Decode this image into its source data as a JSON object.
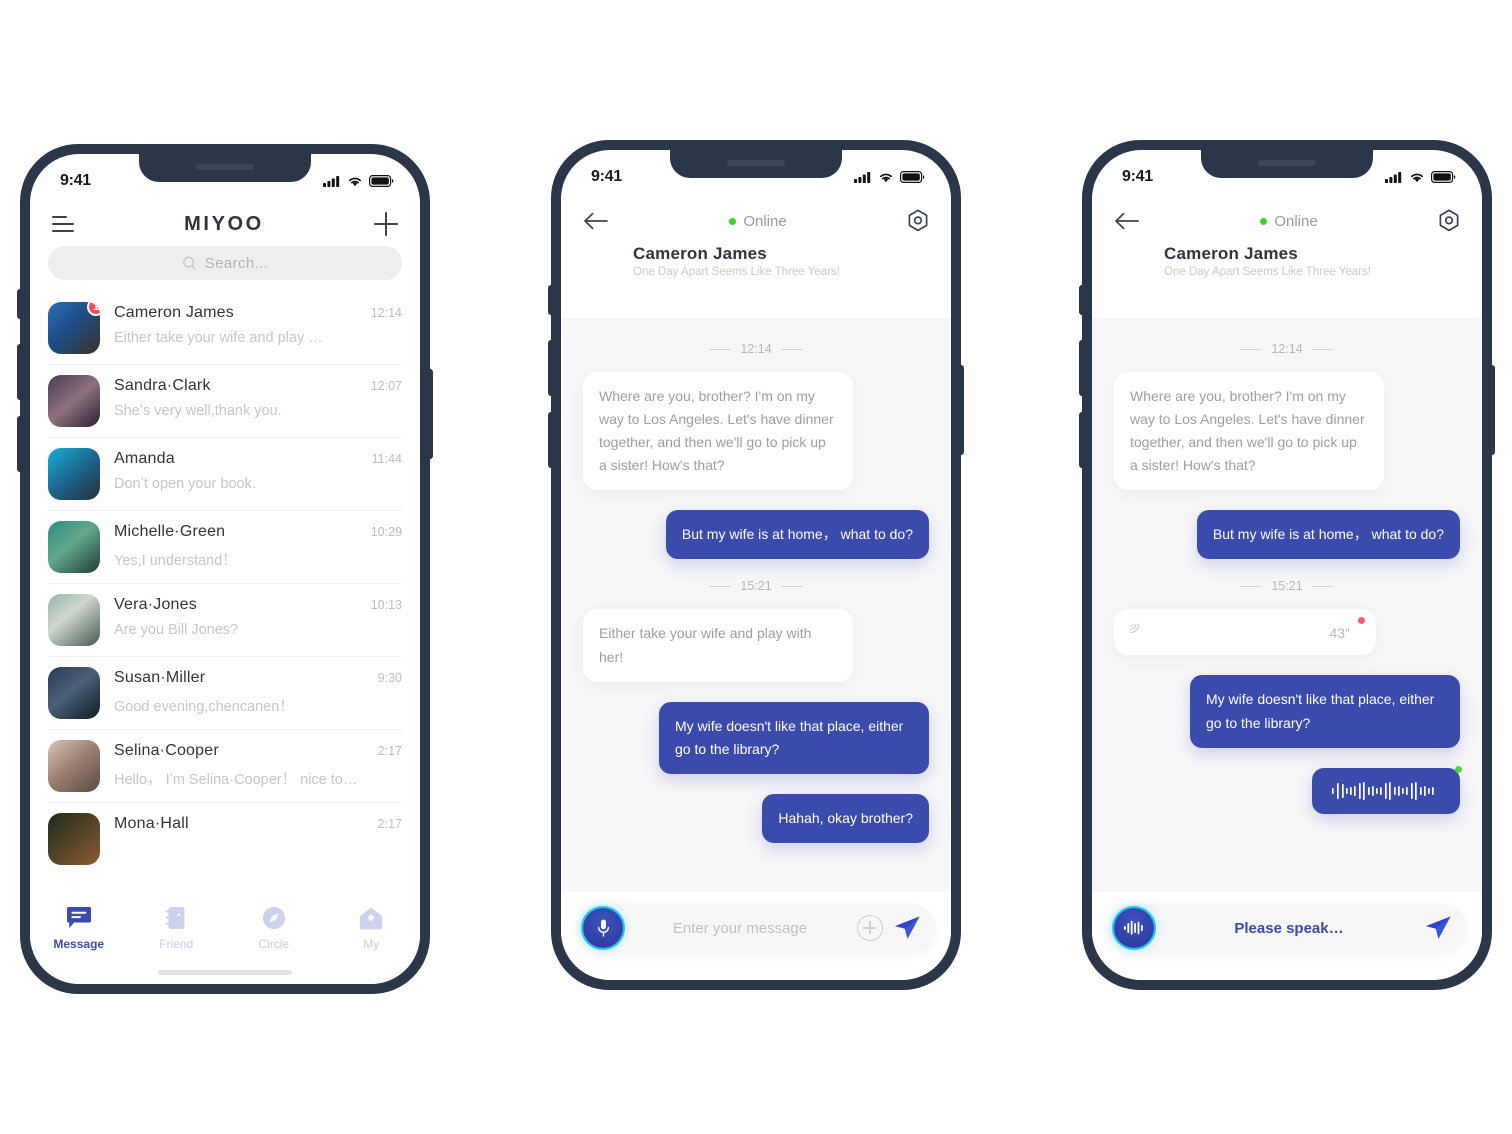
{
  "statusbar": {
    "time": "9:41",
    "icons": [
      "signal-icon",
      "wifi-icon",
      "battery-icon"
    ]
  },
  "colors": {
    "accent_blue": "#3b4bab",
    "frame_navy": "#2b3649",
    "badge_red": "#f24a5d",
    "online_green": "#3ed12b",
    "mic_glow": "#19c6f5",
    "chat_bg": "#f7f7f9"
  },
  "phone1": {
    "header": {
      "title": "MIYOO",
      "menu_icon": "hamburger-icon",
      "add_icon": "plus-icon"
    },
    "search": {
      "placeholder": "Search...",
      "icon": "search-icon"
    },
    "chats": [
      {
        "name": "Cameron James",
        "time": "12:14",
        "preview": "Either take your wife and play …",
        "badge": "1",
        "avatar": "pa1"
      },
      {
        "name": "Sandra·Clark",
        "time": "12:07",
        "preview": "Sheʼs very well,thank you.",
        "badge": "",
        "avatar": "pa2"
      },
      {
        "name": "Amanda",
        "time": "11:44",
        "preview": "Donʼt open your book.",
        "badge": "",
        "avatar": "pa3"
      },
      {
        "name": "Michelle·Green",
        "time": "10:29",
        "preview": "Yes,I understand！",
        "badge": "",
        "avatar": "pa4"
      },
      {
        "name": "Vera·Jones",
        "time": "10:13",
        "preview": "Are you Bill Jones?",
        "badge": "",
        "avatar": "pa5"
      },
      {
        "name": "Susan·Miller",
        "time": "9:30",
        "preview": "Good evening,chencanen！",
        "badge": "",
        "avatar": "pa6"
      },
      {
        "name": "Selina·Cooper",
        "time": "2:17",
        "preview": "Hello， Iʼm Selina·Cooper！ nice to…",
        "badge": "",
        "avatar": "pa7"
      },
      {
        "name": "Mona·Hall",
        "time": "2:17",
        "preview": "",
        "badge": "",
        "avatar": "pa8"
      }
    ],
    "tabs": [
      {
        "label": "Message",
        "icon": "message-icon",
        "active": true
      },
      {
        "label": "Friend",
        "icon": "contacts-book-icon",
        "active": false
      },
      {
        "label": "Circle",
        "icon": "compass-icon",
        "active": false
      },
      {
        "label": "My",
        "icon": "home-icon",
        "active": false
      }
    ]
  },
  "phone2": {
    "header": {
      "back_icon": "back-arrow-icon",
      "status_label": "Online",
      "settings_icon": "settings-hex-icon",
      "peer_name": "Cameron James",
      "peer_signature": "One Day Apart Seems Like Three Years!"
    },
    "messages": [
      {
        "kind": "timestamp",
        "text": "12:14"
      },
      {
        "kind": "text",
        "side": "in",
        "text": "Where are you, brother? I'm on my way to Los Angeles. Let's have dinner together, and then we'll go to pick up a sister! How's that?"
      },
      {
        "kind": "text",
        "side": "out",
        "text": "But my wife is at home， what to do?"
      },
      {
        "kind": "timestamp",
        "text": "15:21"
      },
      {
        "kind": "text",
        "side": "in",
        "text": "Either take your wife and play with her!"
      },
      {
        "kind": "text",
        "side": "out",
        "text": "My wife doesn't like that place, either go to the library?"
      },
      {
        "kind": "text",
        "side": "out",
        "text": "Hahah, okay brother?"
      }
    ],
    "input": {
      "mic_icon": "microphone-icon",
      "placeholder": "Enter your message",
      "attach_icon": "plus-circle-icon",
      "send_icon": "send-paper-plane-icon"
    }
  },
  "phone3": {
    "header": {
      "back_icon": "back-arrow-icon",
      "status_label": "Online",
      "settings_icon": "settings-hex-icon",
      "peer_name": "Cameron James",
      "peer_signature": "One Day Apart Seems Like Three Years!"
    },
    "messages": [
      {
        "kind": "timestamp",
        "text": "12:14"
      },
      {
        "kind": "text",
        "side": "in",
        "text": "Where are you, brother? I'm on my way to Los Angeles. Let's have dinner together, and then we'll go to pick up a sister! How's that?"
      },
      {
        "kind": "text",
        "side": "out",
        "text": "But my wife is at home， what to do?"
      },
      {
        "kind": "timestamp",
        "text": "15:21"
      },
      {
        "kind": "voice",
        "side": "in",
        "duration": "43″",
        "unread": true,
        "icon": "sound-wave-icon"
      },
      {
        "kind": "text",
        "side": "out",
        "text": "My wife doesn't like that place, either go to the library?"
      },
      {
        "kind": "voice",
        "side": "out",
        "icon": "audio-waveform-icon",
        "unread": true
      }
    ],
    "input": {
      "mic_icon": "audio-waveform-icon",
      "placeholder": "Please speak…",
      "send_icon": "send-paper-plane-icon"
    }
  }
}
